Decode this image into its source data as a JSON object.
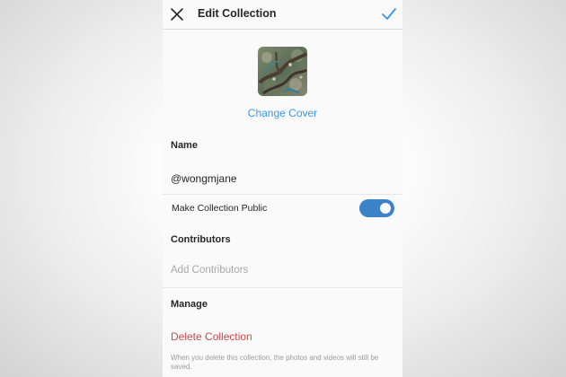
{
  "header": {
    "title": "Edit Collection",
    "close_icon": "close-icon",
    "done_icon": "checkmark-icon"
  },
  "cover": {
    "image": "cover-thumbnail",
    "change_label": "Change Cover"
  },
  "name_section": {
    "label": "Name",
    "value": "@wongmjane"
  },
  "public_toggle": {
    "label": "Make Collection Public",
    "enabled": true
  },
  "contributors_section": {
    "label": "Contributors",
    "placeholder": "Add Contributors"
  },
  "manage_section": {
    "label": "Manage",
    "delete_label": "Delete Collection",
    "delete_note": "When you delete this collection, the photos and videos will still be saved."
  },
  "colors": {
    "link_blue": "#3897f0",
    "toggle_blue": "#3c82c8",
    "delete_red": "#c9484c",
    "text_dark": "#262626",
    "text_muted": "#a8a8a8"
  }
}
